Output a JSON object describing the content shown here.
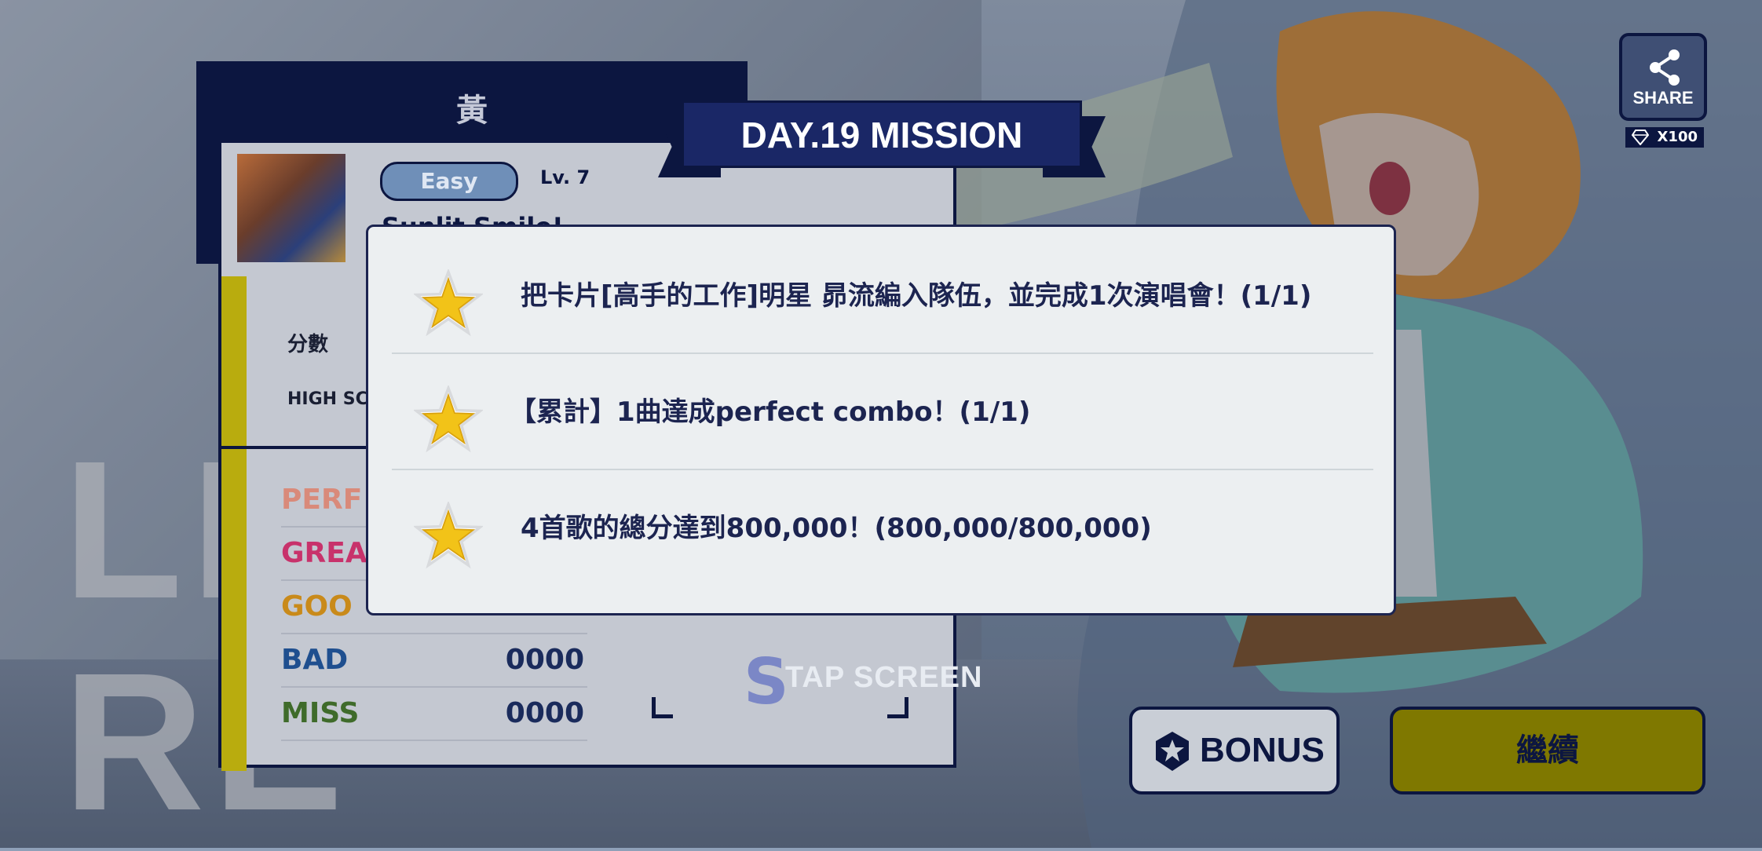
{
  "background": {
    "big_text_lines": [
      "LI",
      "RE"
    ]
  },
  "result": {
    "attribute": "黃",
    "difficulty": "Easy",
    "level": "Lv. 7",
    "song_title": "Sunlit Smile!",
    "score_label": "分數",
    "high_score_label": "HIGH SCO",
    "judgements": [
      {
        "name": "PERF",
        "value": "",
        "color": "#d98a7a"
      },
      {
        "name": "GREA",
        "value": "",
        "color": "#c8326b"
      },
      {
        "name": "GOO",
        "value": "",
        "color": "#c98a1a"
      },
      {
        "name": "BAD",
        "value": "0000",
        "color": "#1f4f8f"
      },
      {
        "name": "MISS",
        "value": "0000",
        "color": "#3f6b2a"
      }
    ],
    "rank": "S"
  },
  "mission": {
    "banner": "DAY.19 MISSION",
    "items": [
      {
        "text": "把卡片[高手的工作]明星 昴流編入隊伍，並完成1次演唱會！(1/1)",
        "icon": "star-icon"
      },
      {
        "text": "【累計】1曲達成perfect combo！(1/1)",
        "icon": "star-icon"
      },
      {
        "text": "4首歌的總分達到800,000！(800,000/800,000)",
        "icon": "star-icon"
      }
    ]
  },
  "tap_screen": "TAP SCREEN",
  "buttons": {
    "bonus": "BONUS",
    "continue": "繼續",
    "share": "SHARE",
    "gem_count": "X100"
  },
  "colors": {
    "navy": "#0c1640",
    "modal_bg": "#eceff1",
    "star": "#f2c318",
    "continue_bg": "#7f7800"
  }
}
